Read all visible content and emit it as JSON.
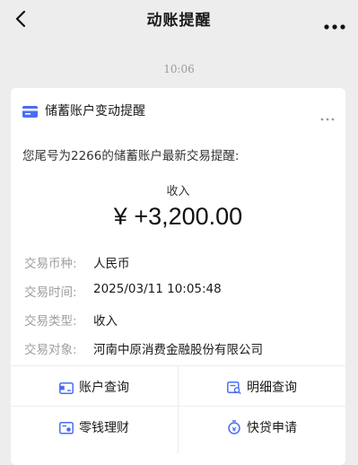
{
  "nav": {
    "title": "动账提醒"
  },
  "time": "10:06",
  "card": {
    "title": "储蓄账户变动提醒",
    "intro": "您尾号为2266的储蓄账户最新交易提醒:",
    "amount_label": "收入",
    "amount": "¥ +3,200.00",
    "details": [
      {
        "label": "交易币种:",
        "value": "人民币"
      },
      {
        "label": "交易时间:",
        "value": "2025/03/11 10:05:48"
      },
      {
        "label": "交易类型:",
        "value": "收入"
      },
      {
        "label": "交易对象:",
        "value": "河南中原消费金融股份有限公司"
      }
    ],
    "actions": [
      {
        "label": "账户查询",
        "icon": "card-icon"
      },
      {
        "label": "明细查询",
        "icon": "bill-search-icon"
      },
      {
        "label": "零钱理财",
        "icon": "wealth-icon"
      },
      {
        "label": "快贷申请",
        "icon": "loan-icon"
      }
    ]
  },
  "colors": {
    "background": "#ededed",
    "card": "#ffffff",
    "accent": "#4a6cf7",
    "label_gray": "#9e9e9e"
  }
}
